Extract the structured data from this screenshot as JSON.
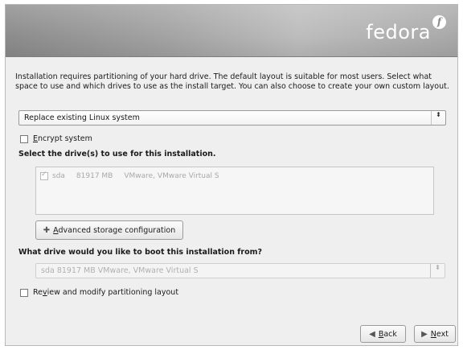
{
  "header": {
    "logo_text": "fedora",
    "logo_badge": "f"
  },
  "intro_text": "Installation requires partitioning of your hard drive.  The default layout is suitable for most users.  Select what space to use and which drives to use as the install target. You can also choose to create your own custom layout.",
  "layout_select": {
    "value": "Replace existing Linux system",
    "arrow": "⬍"
  },
  "encrypt": {
    "label_prefix": "",
    "label_accel": "E",
    "label_rest": "ncrypt system",
    "checked": false
  },
  "drives": {
    "heading": "Select the drive(s) to use for this installation.",
    "items": [
      {
        "device": "sda",
        "size": "81917 MB",
        "model": "VMware, VMware Virtual S",
        "checked": true
      }
    ]
  },
  "advanced_button": {
    "icon": "✚",
    "accel": "A",
    "rest": "dvanced storage configuration"
  },
  "boot": {
    "heading": "What drive would you like to boot this installation from?",
    "value": "sda    81917 MB VMware, VMware Virtual S",
    "arrow": "⬍"
  },
  "review": {
    "label_prefix": "Re",
    "label_accel": "v",
    "label_rest": "iew and modify partitioning layout",
    "checked": false
  },
  "nav": {
    "back_icon": "◀",
    "back_accel": "B",
    "back_rest": "ack",
    "next_icon": "▶",
    "next_accel": "N",
    "next_rest": "ext"
  }
}
